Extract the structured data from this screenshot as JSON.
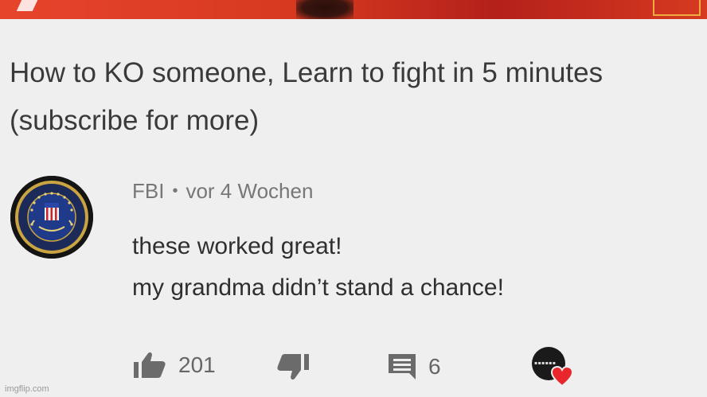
{
  "video": {
    "title": "How to KO someone, Learn to fight in 5 minutes (subscribe for more)"
  },
  "comment": {
    "author": "FBI",
    "separator": "•",
    "timestamp": "vor 4 Wochen",
    "lines": [
      "these worked great!",
      "my grandma didn’t stand a chance!"
    ],
    "avatar_icon": "fbi-seal-icon"
  },
  "actions": {
    "like_icon": "thumbs-up-icon",
    "like_count": "201",
    "dislike_icon": "thumbs-down-icon",
    "reply_icon": "reply-comment-icon",
    "reply_count": "6",
    "creator_heart_icon": "creator-heart-icon"
  },
  "colors": {
    "strip": "#d4381f",
    "heart": "#e8262b",
    "icon": "#6b6b6b"
  },
  "watermark": "imgflip.com"
}
